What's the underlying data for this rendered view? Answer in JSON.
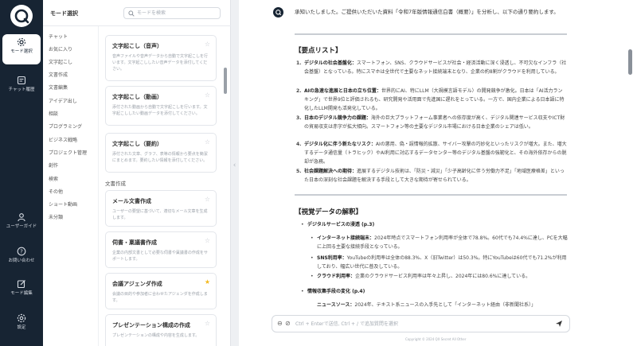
{
  "rail": {
    "items": [
      {
        "label": "モード選択",
        "icon": "gear-icon"
      },
      {
        "label": "チャット履歴",
        "icon": "history-icon"
      },
      {
        "label": "ユーザーガイド",
        "icon": "user-icon"
      },
      {
        "label": "お問い合わせ",
        "icon": "help-icon"
      },
      {
        "label": "モード編集",
        "icon": "edit-icon"
      },
      {
        "label": "設定",
        "icon": "settings-icon"
      }
    ]
  },
  "panel": {
    "title": "モード選択",
    "search_placeholder": "モードを検索",
    "categories": [
      "チャット",
      "お気に入り",
      "文字起こし",
      "文書作成",
      "文書編集",
      "アイデア出し",
      "相談",
      "プログラミング",
      "ビジネス戦略",
      "プロジェクト管理",
      "創作",
      "検索",
      "その他",
      "ショート動画",
      "未分類"
    ],
    "cards_top": [
      {
        "title": "文字起こし（音声）",
        "desc": "音声ファイルや音声データから自動で文字起こしを行います。文字起こししたい音声データを添付してください。",
        "starred": false
      },
      {
        "title": "文字起こし（動画）",
        "desc": "添付された動画から自動で文字起こしを行います。文字起こししたい動画データを添付してください。",
        "starred": false
      },
      {
        "title": "文字起こし（要約）",
        "desc": "添付された文章、グラフ、表等の情報から要点を簡潔にまとめます。要約したい情報を添付してください。",
        "starred": false
      }
    ],
    "section_label": "文書作成",
    "cards_bottom": [
      {
        "title": "メール文書作成",
        "desc": "ユーザーの要望に基づいて、適切なメール文章を生成します。",
        "starred": false
      },
      {
        "title": "伺書・稟議書作成",
        "desc": "企業の内部文書として必要な伺書や稟議書の作成をサポートします。",
        "starred": false
      },
      {
        "title": "会議アジェンダ作成",
        "desc": "会議の目的や参加者に合わせたアジェンダを作成します。",
        "starred": true
      },
      {
        "title": "プレゼンテーション構成の作成",
        "desc": "プレゼンテーションの構成や内容を生成します。",
        "starred": false
      }
    ]
  },
  "chat": {
    "intro": "承知いたしました。ご提供いただいた資料「令和7年版情報通信白書（概要）」を分析し、以下の通り要約します。",
    "summary_title": "【要点リスト】",
    "points": [
      {
        "num": "1.",
        "head": "デジタルの社会基盤化：",
        "text": "スマートフォン、SNS、クラウドサービスが社会・経済活動に深く浸透し、不可欠なインフラ（社会基盤）となっている。特にスマホは全世代で主要なネット接続端末となり、企業の約8割がクラウドを利用している。"
      },
      {
        "num": "2.",
        "head": "AIの急速な進展と日本の立ち位置：",
        "text": "世界的にAI、特にLLM（大規模言語モデル）の開発競争が激化。日本は「AI活力ランキング」で世界9位と評価されるも、研究開発や活用面で先進国に遅れをとっている。一方で、国内企業による日本語に特化したLLM開発も活発化している。"
      },
      {
        "num": "3.",
        "head": "日本のデジタル競争力の課題：",
        "text": "海外の巨大プラットフォーム事業者への依存度が高く、デジタル関連サービス収支やICT財の貿易収支は赤字が拡大傾向。スマートフォン等の主要なデジタル市場における日本企業のシェアは低い。"
      },
      {
        "num": "4.",
        "head": "デジタル化に伴う新たなリスク：",
        "text": "AIの悪用、偽・誤情報的拡散、サイバー攻撃の巧妙化といったリスクが増大。また、増大するデータ通信量（トラヒック）やAI利用に対応するデータセンター等のデジタル基盤の強靭化と、その海外依存からの脱却が急務。"
      },
      {
        "num": "5.",
        "head": "社会課題解決への期待：",
        "text": "進展するデジタル技術は、「防災・減災」「少子高齢化に伴う労働力不足」「地域医療格差」といった日本の深刻な社会課題を解決する手段として大きな期待が寄せられている。"
      }
    ],
    "visual_title": "【視覚データの解釈】",
    "visual_items": [
      {
        "head": "デジタルサービスの浸透 (p.3)",
        "subs": [
          {
            "head": "インターネット接続端末：",
            "text": "2024年時点でスマートフォン利用率が全体で78.8%。60代でも74.4%に達し、PCを大幅に上回る主要な接続手段となっている。"
          },
          {
            "head": "SNS利用率：",
            "text": "YouTubeの利用率は全体の88.3%、X（旧Twitter）は50.3%。特にYouTubeは60代でも71.2%が利用しており、幅広い世代に普及している。"
          },
          {
            "head": "クラウド利用率：",
            "text": "企業のクラウドサービス利用率は年々上昇し、2024年には80.6%に達している。"
          }
        ]
      },
      {
        "head": "情報収集手段の変化 (p.4)",
        "subs": [
          {
            "head": "ニュースソース：",
            "text": "2024年、テキスト系ニュースの入手先として「インターネット経由（非新聞社系）」"
          }
        ]
      }
    ],
    "composer_placeholder": "Ctrl + Enterで送信, Ctrl + / で追加質問を選択",
    "copyright": "Copyright © 2024 QX Secret All Other"
  }
}
